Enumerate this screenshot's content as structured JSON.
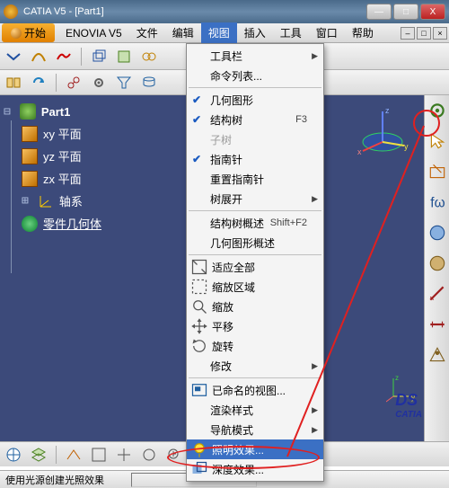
{
  "window": {
    "title": "CATIA V5 - [Part1]",
    "min": "—",
    "max": "□",
    "close": "X"
  },
  "menubar": {
    "start": "开始",
    "enovia": "ENOVIA V5",
    "file": "文件",
    "edit": "编辑",
    "view": "视图",
    "insert": "插入",
    "tools": "工具",
    "window": "窗口",
    "help": "帮助"
  },
  "tree": {
    "root": "Part1",
    "xy": "xy 平面",
    "yz": "yz 平面",
    "zx": "zx 平面",
    "axes": "轴系",
    "body": "零件几何体"
  },
  "view_menu": {
    "toolbars": "工具栏",
    "cmdlist": "命令列表...",
    "geom": "几何图形",
    "spectree": "结构树",
    "spectree_sc": "F3",
    "subtree": "子树",
    "compass": "指南针",
    "reset_compass": "重置指南针",
    "tree_expand": "树展开",
    "spec_overview": "结构树概述",
    "spec_overview_sc": "Shift+F2",
    "geom_overview": "几何图形概述",
    "fit_all": "适应全部",
    "zoom_area": "缩放区域",
    "zoom": "缩放",
    "pan": "平移",
    "rotate": "旋转",
    "modify": "修改",
    "named_views": "已命名的视图...",
    "render_style": "渲染样式",
    "nav_mode": "导航模式",
    "lighting": "照明效果...",
    "depth": "深度效果..."
  },
  "status": {
    "text": "使用光源创建光照效果"
  },
  "logo": {
    "ds": "DS",
    "name": "CATIA"
  }
}
